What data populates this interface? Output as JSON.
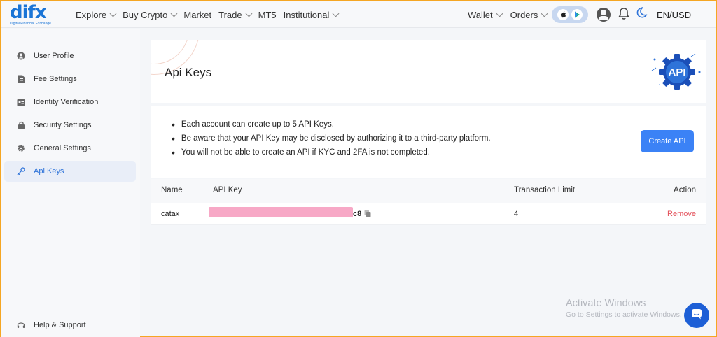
{
  "brand": {
    "name": "difx",
    "tagline": "Digital Financial Exchange"
  },
  "nav": {
    "left": [
      "Explore",
      "Buy Crypto",
      "Market",
      "Trade",
      "MT5",
      "Institutional"
    ],
    "wallet": "Wallet",
    "orders": "Orders",
    "lang_currency": "EN/USD"
  },
  "sidebar": {
    "items": [
      {
        "label": "User Profile",
        "icon": "user-icon"
      },
      {
        "label": "Fee Settings",
        "icon": "document-icon"
      },
      {
        "label": "Identity Verification",
        "icon": "id-card-icon"
      },
      {
        "label": "Security Settings",
        "icon": "lock-icon"
      },
      {
        "label": "General Settings",
        "icon": "gear-icon"
      },
      {
        "label": "Api Keys",
        "icon": "key-icon",
        "active": true
      }
    ],
    "help": "Help & Support"
  },
  "page": {
    "title": "Api Keys",
    "badge": "API",
    "info": [
      "Each account can create up to 5 API Keys.",
      "Be aware that your API Key may be disclosed by authorizing it to a third-party platform.",
      "You will not be able to create an API if KYC and 2FA is not completed."
    ],
    "create_button": "Create API"
  },
  "table": {
    "headers": [
      "Name",
      "API Key",
      "Transaction Limit",
      "Action"
    ],
    "rows": [
      {
        "name": "catax",
        "api_key_suffix": "c8",
        "limit": "4",
        "action": "Remove"
      }
    ]
  },
  "watermark": {
    "line1": "Activate Windows",
    "line2": "Go to Settings to activate Windows."
  },
  "colors": {
    "accent": "#3b82f6",
    "brand": "#1b75d6",
    "danger": "#e3505a",
    "redaction": "#f7a8c6",
    "frame": "#f5a623"
  }
}
